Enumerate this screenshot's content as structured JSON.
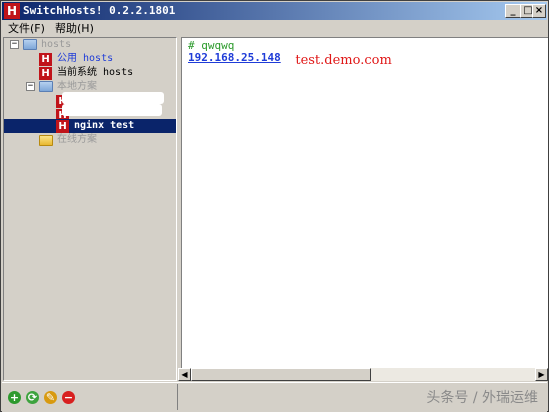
{
  "window": {
    "title": "SwitchHosts! 0.2.2.1801",
    "app_icon_letter": "H",
    "minimize": "_",
    "maximize": "□",
    "close": "×"
  },
  "menu": {
    "items": [
      {
        "label": "文件(F)"
      },
      {
        "label": "帮助(H)"
      }
    ]
  },
  "tree": {
    "root": {
      "label": "hosts",
      "expander": "−"
    },
    "public": {
      "label": "公用 hosts",
      "icon_letter": "H"
    },
    "current_system": {
      "label": "当前系统 hosts",
      "icon_letter": "H"
    },
    "local_schemes": {
      "label": "本地方案",
      "expander": "−"
    },
    "local_items": [
      {
        "label": "",
        "icon_letter": "H"
      },
      {
        "label": "",
        "icon_letter": "H"
      },
      {
        "label": "nginx test",
        "icon_letter": "H",
        "selected": true
      }
    ],
    "online_schemes": {
      "label": "在线方案"
    }
  },
  "editor": {
    "lines": [
      {
        "text": "# qwqwq",
        "kind": "comment"
      },
      {
        "ip": "192.168.25.148",
        "host": "test.demo.com"
      }
    ]
  },
  "scrollbar": {
    "left_arrow": "◀",
    "right_arrow": "▶"
  },
  "toolbar": {
    "buttons": [
      {
        "name": "add",
        "glyph": "+",
        "color": "#2e9a2e"
      },
      {
        "name": "refresh",
        "glyph": "⟳",
        "color": "#3ea33e"
      },
      {
        "name": "edit",
        "glyph": "✎",
        "color": "#d89a10"
      },
      {
        "name": "delete",
        "glyph": "−",
        "color": "#d82020"
      }
    ]
  },
  "watermark": "头条号 / 外瑞运维"
}
